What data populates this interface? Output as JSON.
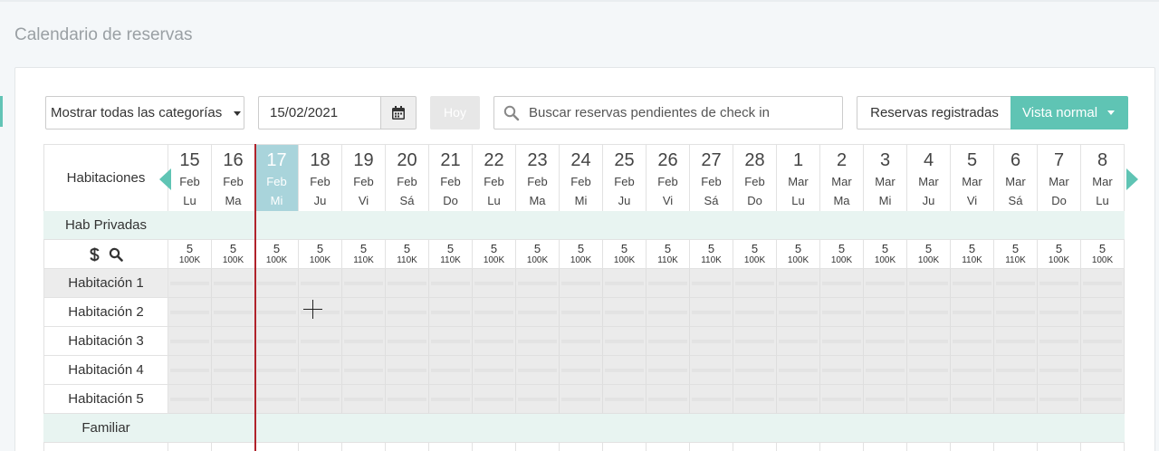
{
  "page_title": "Calendario de reservas",
  "toolbar": {
    "category_select": "Mostrar todas las categorías",
    "date_value": "15/02/2021",
    "today_label": "Hoy",
    "search_placeholder": "Buscar reservas pendientes de check in",
    "registered_label": "Reservas registradas",
    "view_label": "Vista normal"
  },
  "calendar": {
    "rooms_header": "Habitaciones",
    "today_index": 2,
    "days": [
      {
        "d": "15",
        "m": "Feb",
        "w": "Lu"
      },
      {
        "d": "16",
        "m": "Feb",
        "w": "Ma"
      },
      {
        "d": "17",
        "m": "Feb",
        "w": "Mi"
      },
      {
        "d": "18",
        "m": "Feb",
        "w": "Ju"
      },
      {
        "d": "19",
        "m": "Feb",
        "w": "Vi"
      },
      {
        "d": "20",
        "m": "Feb",
        "w": "Sá"
      },
      {
        "d": "21",
        "m": "Feb",
        "w": "Do"
      },
      {
        "d": "22",
        "m": "Feb",
        "w": "Lu"
      },
      {
        "d": "23",
        "m": "Feb",
        "w": "Ma"
      },
      {
        "d": "24",
        "m": "Feb",
        "w": "Mi"
      },
      {
        "d": "25",
        "m": "Feb",
        "w": "Ju"
      },
      {
        "d": "26",
        "m": "Feb",
        "w": "Vi"
      },
      {
        "d": "27",
        "m": "Feb",
        "w": "Sá"
      },
      {
        "d": "28",
        "m": "Feb",
        "w": "Do"
      },
      {
        "d": "1",
        "m": "Mar",
        "w": "Lu"
      },
      {
        "d": "2",
        "m": "Mar",
        "w": "Ma"
      },
      {
        "d": "3",
        "m": "Mar",
        "w": "Mi"
      },
      {
        "d": "4",
        "m": "Mar",
        "w": "Ju"
      },
      {
        "d": "5",
        "m": "Mar",
        "w": "Vi"
      },
      {
        "d": "6",
        "m": "Mar",
        "w": "Sá"
      },
      {
        "d": "7",
        "m": "Mar",
        "w": "Do"
      },
      {
        "d": "8",
        "m": "Mar",
        "w": "Lu"
      }
    ],
    "categories": [
      {
        "name": "Hab Privadas",
        "availability": [
          "5",
          "5",
          "5",
          "5",
          "5",
          "5",
          "5",
          "5",
          "5",
          "5",
          "5",
          "5",
          "5",
          "5",
          "5",
          "5",
          "5",
          "5",
          "5",
          "5",
          "5",
          "5"
        ],
        "prices": [
          "100K",
          "100K",
          "100K",
          "100K",
          "110K",
          "110K",
          "110K",
          "100K",
          "100K",
          "100K",
          "100K",
          "110K",
          "110K",
          "100K",
          "100K",
          "100K",
          "100K",
          "100K",
          "110K",
          "110K",
          "100K",
          "100K"
        ],
        "rooms": [
          "Habitación 1",
          "Habitación 2",
          "Habitación 3",
          "Habitación 4",
          "Habitación 5"
        ]
      },
      {
        "name": "Familiar"
      }
    ]
  },
  "colors": {
    "accent": "#5fc4b4",
    "today_column": "#a9d4db",
    "today_line": "#b0232b",
    "category_row": "#e8f4f1"
  }
}
